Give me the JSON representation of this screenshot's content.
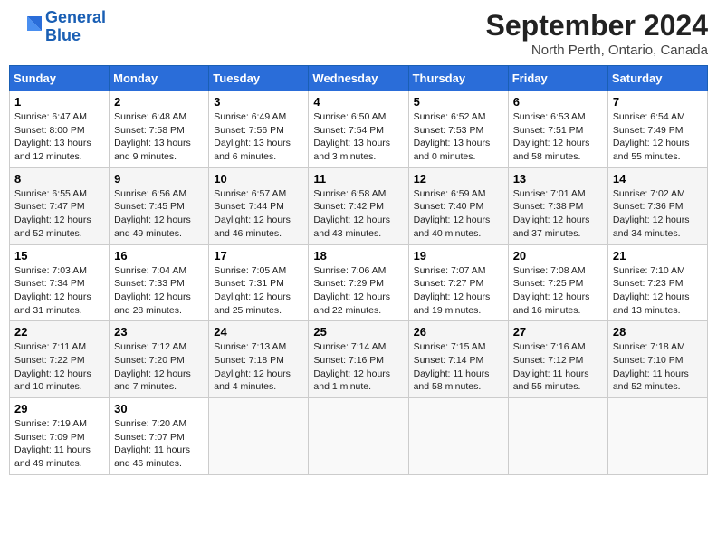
{
  "logo": {
    "line1": "General",
    "line2": "Blue"
  },
  "title": "September 2024",
  "location": "North Perth, Ontario, Canada",
  "days_of_week": [
    "Sunday",
    "Monday",
    "Tuesday",
    "Wednesday",
    "Thursday",
    "Friday",
    "Saturday"
  ],
  "weeks": [
    [
      {
        "day": "1",
        "sunrise": "6:47 AM",
        "sunset": "8:00 PM",
        "daylight": "13 hours and 12 minutes."
      },
      {
        "day": "2",
        "sunrise": "6:48 AM",
        "sunset": "7:58 PM",
        "daylight": "13 hours and 9 minutes."
      },
      {
        "day": "3",
        "sunrise": "6:49 AM",
        "sunset": "7:56 PM",
        "daylight": "13 hours and 6 minutes."
      },
      {
        "day": "4",
        "sunrise": "6:50 AM",
        "sunset": "7:54 PM",
        "daylight": "13 hours and 3 minutes."
      },
      {
        "day": "5",
        "sunrise": "6:52 AM",
        "sunset": "7:53 PM",
        "daylight": "13 hours and 0 minutes."
      },
      {
        "day": "6",
        "sunrise": "6:53 AM",
        "sunset": "7:51 PM",
        "daylight": "12 hours and 58 minutes."
      },
      {
        "day": "7",
        "sunrise": "6:54 AM",
        "sunset": "7:49 PM",
        "daylight": "12 hours and 55 minutes."
      }
    ],
    [
      {
        "day": "8",
        "sunrise": "6:55 AM",
        "sunset": "7:47 PM",
        "daylight": "12 hours and 52 minutes."
      },
      {
        "day": "9",
        "sunrise": "6:56 AM",
        "sunset": "7:45 PM",
        "daylight": "12 hours and 49 minutes."
      },
      {
        "day": "10",
        "sunrise": "6:57 AM",
        "sunset": "7:44 PM",
        "daylight": "12 hours and 46 minutes."
      },
      {
        "day": "11",
        "sunrise": "6:58 AM",
        "sunset": "7:42 PM",
        "daylight": "12 hours and 43 minutes."
      },
      {
        "day": "12",
        "sunrise": "6:59 AM",
        "sunset": "7:40 PM",
        "daylight": "12 hours and 40 minutes."
      },
      {
        "day": "13",
        "sunrise": "7:01 AM",
        "sunset": "7:38 PM",
        "daylight": "12 hours and 37 minutes."
      },
      {
        "day": "14",
        "sunrise": "7:02 AM",
        "sunset": "7:36 PM",
        "daylight": "12 hours and 34 minutes."
      }
    ],
    [
      {
        "day": "15",
        "sunrise": "7:03 AM",
        "sunset": "7:34 PM",
        "daylight": "12 hours and 31 minutes."
      },
      {
        "day": "16",
        "sunrise": "7:04 AM",
        "sunset": "7:33 PM",
        "daylight": "12 hours and 28 minutes."
      },
      {
        "day": "17",
        "sunrise": "7:05 AM",
        "sunset": "7:31 PM",
        "daylight": "12 hours and 25 minutes."
      },
      {
        "day": "18",
        "sunrise": "7:06 AM",
        "sunset": "7:29 PM",
        "daylight": "12 hours and 22 minutes."
      },
      {
        "day": "19",
        "sunrise": "7:07 AM",
        "sunset": "7:27 PM",
        "daylight": "12 hours and 19 minutes."
      },
      {
        "day": "20",
        "sunrise": "7:08 AM",
        "sunset": "7:25 PM",
        "daylight": "12 hours and 16 minutes."
      },
      {
        "day": "21",
        "sunrise": "7:10 AM",
        "sunset": "7:23 PM",
        "daylight": "12 hours and 13 minutes."
      }
    ],
    [
      {
        "day": "22",
        "sunrise": "7:11 AM",
        "sunset": "7:22 PM",
        "daylight": "12 hours and 10 minutes."
      },
      {
        "day": "23",
        "sunrise": "7:12 AM",
        "sunset": "7:20 PM",
        "daylight": "12 hours and 7 minutes."
      },
      {
        "day": "24",
        "sunrise": "7:13 AM",
        "sunset": "7:18 PM",
        "daylight": "12 hours and 4 minutes."
      },
      {
        "day": "25",
        "sunrise": "7:14 AM",
        "sunset": "7:16 PM",
        "daylight": "12 hours and 1 minute."
      },
      {
        "day": "26",
        "sunrise": "7:15 AM",
        "sunset": "7:14 PM",
        "daylight": "11 hours and 58 minutes."
      },
      {
        "day": "27",
        "sunrise": "7:16 AM",
        "sunset": "7:12 PM",
        "daylight": "11 hours and 55 minutes."
      },
      {
        "day": "28",
        "sunrise": "7:18 AM",
        "sunset": "7:10 PM",
        "daylight": "11 hours and 52 minutes."
      }
    ],
    [
      {
        "day": "29",
        "sunrise": "7:19 AM",
        "sunset": "7:09 PM",
        "daylight": "11 hours and 49 minutes."
      },
      {
        "day": "30",
        "sunrise": "7:20 AM",
        "sunset": "7:07 PM",
        "daylight": "11 hours and 46 minutes."
      },
      null,
      null,
      null,
      null,
      null
    ]
  ]
}
